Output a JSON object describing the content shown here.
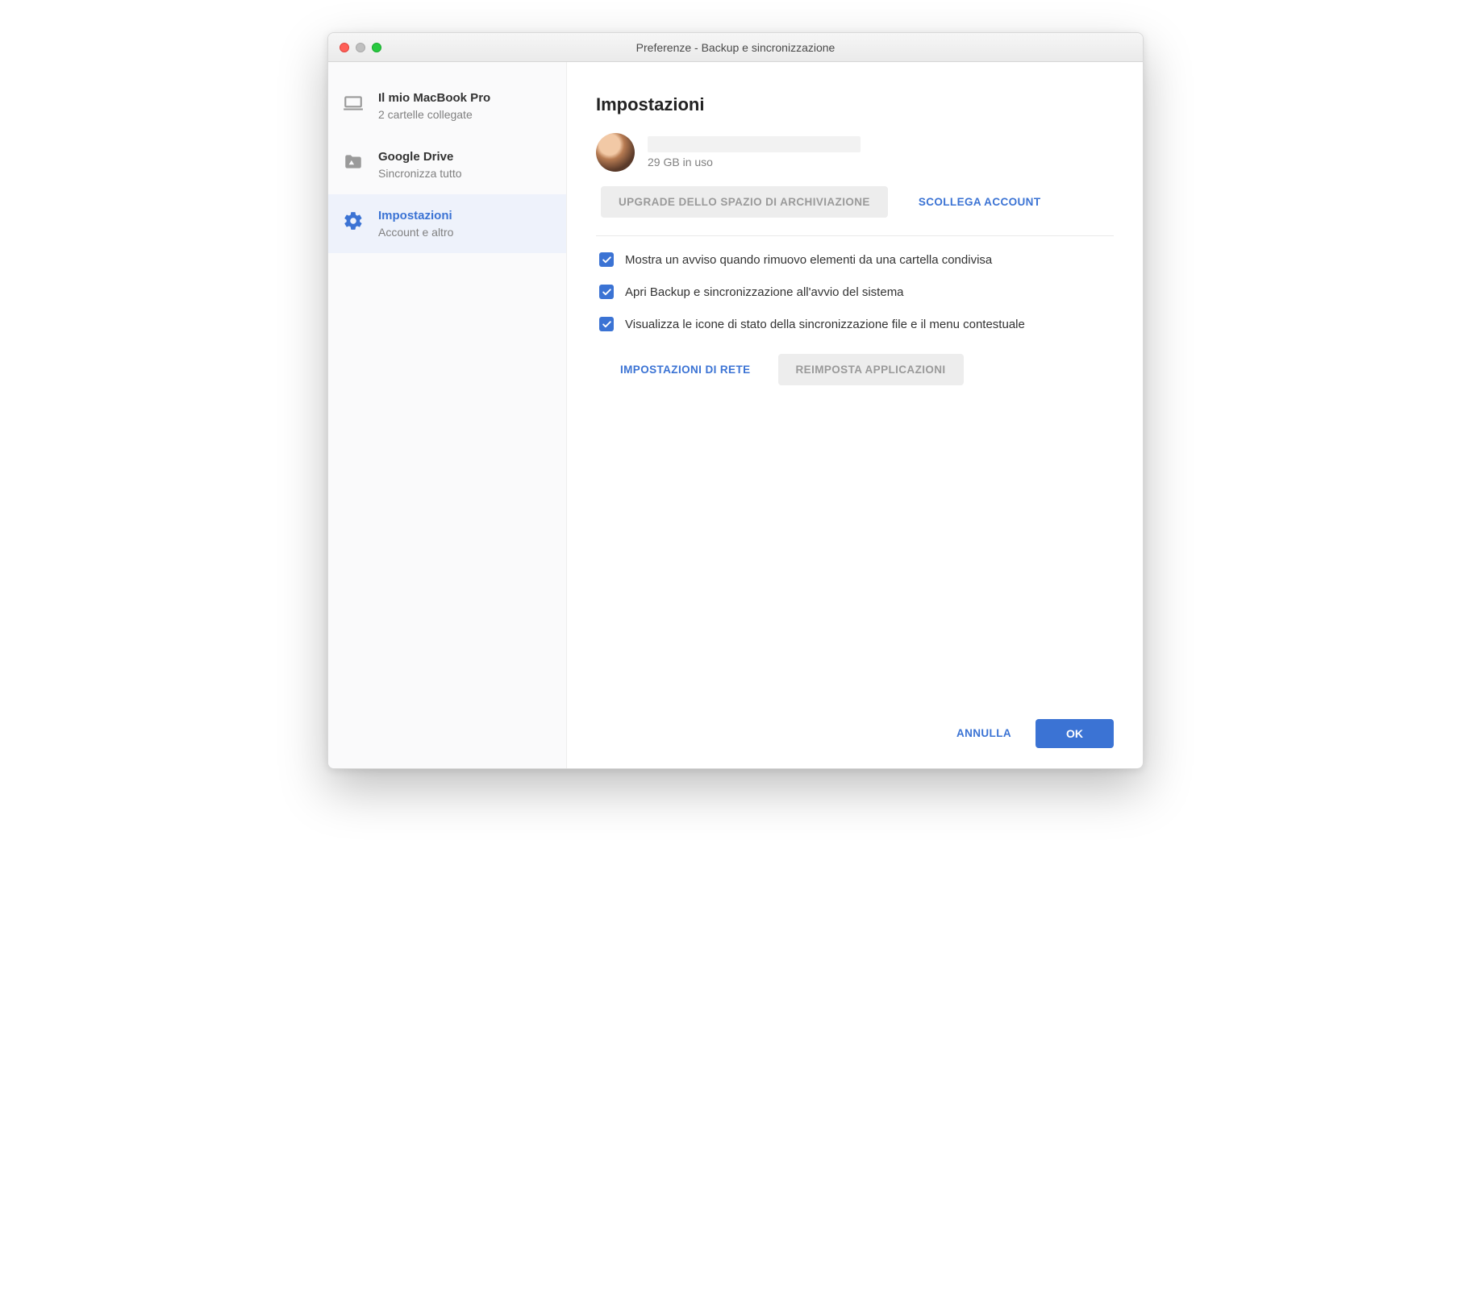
{
  "window": {
    "title": "Preferenze - Backup e sincronizzazione"
  },
  "sidebar": {
    "items": [
      {
        "title": "Il mio MacBook Pro",
        "subtitle": "2 cartelle collegate"
      },
      {
        "title": "Google Drive",
        "subtitle": "Sincronizza tutto"
      },
      {
        "title": "Impostazioni",
        "subtitle": "Account e altro"
      }
    ]
  },
  "main": {
    "heading": "Impostazioni",
    "account": {
      "storage": "29 GB in uso"
    },
    "buttons": {
      "upgrade": "UPGRADE DELLO SPAZIO DI ARCHIVIAZIONE",
      "unlink": "SCOLLEGA ACCOUNT",
      "network": "IMPOSTAZIONI DI RETE",
      "reset": "REIMPOSTA APPLICAZIONI"
    },
    "checkboxes": [
      {
        "label": "Mostra un avviso quando rimuovo elementi da una cartella condivisa",
        "checked": true
      },
      {
        "label": "Apri Backup e sincronizzazione all'avvio del sistema",
        "checked": true
      },
      {
        "label": "Visualizza le icone di stato della sincronizzazione file e il menu contestuale",
        "checked": true
      }
    ]
  },
  "footer": {
    "cancel": "ANNULLA",
    "ok": "OK"
  }
}
